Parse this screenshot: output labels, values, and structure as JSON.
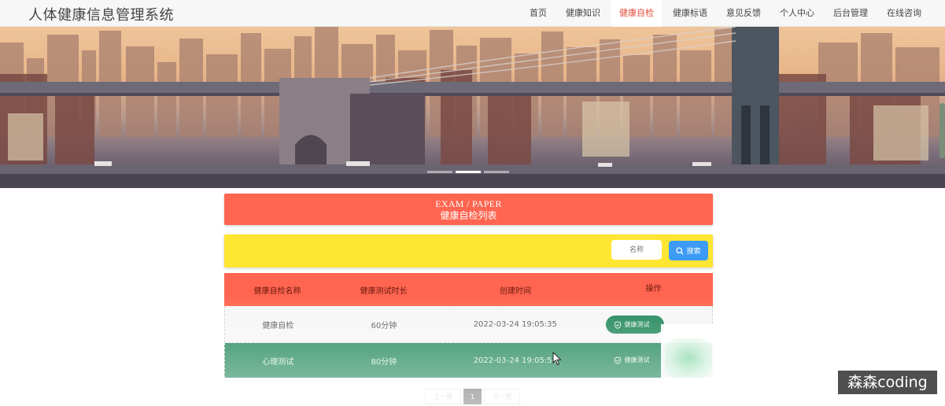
{
  "header": {
    "site_title": "人体健康信息管理系统",
    "nav": [
      {
        "label": "首页",
        "active": false
      },
      {
        "label": "健康知识",
        "active": false
      },
      {
        "label": "健康自检",
        "active": true
      },
      {
        "label": "健康标语",
        "active": false
      },
      {
        "label": "意见反馈",
        "active": false
      },
      {
        "label": "个人中心",
        "active": false
      },
      {
        "label": "后台管理",
        "active": false
      },
      {
        "label": "在线咨询",
        "active": false
      }
    ]
  },
  "banner": {
    "slides": 3,
    "active_slide": 1
  },
  "section": {
    "title_en": "EXAM / PAPER",
    "title_cn": "健康自检列表"
  },
  "search": {
    "placeholder": "名称",
    "button_label": "搜索"
  },
  "table": {
    "headers": [
      "健康自检名称",
      "健康测试时长",
      "创建时间",
      "操作"
    ],
    "rows": [
      {
        "name": "健康自检",
        "duration": "60分钟",
        "created": "2022-03-24 19:05:35",
        "action": "健康测试"
      },
      {
        "name": "心理测试",
        "duration": "80分钟",
        "created": "2022-03-24 19:05:54",
        "action": "健康测试"
      }
    ]
  },
  "pagination": {
    "prev": "上一页",
    "current": "1",
    "next": "下一页"
  },
  "watermark": "森森coding",
  "colors": {
    "accent_red": "#ff6550",
    "search_yellow": "#ffe633",
    "button_blue": "#3d9bf5",
    "row_green": "#21875a"
  }
}
